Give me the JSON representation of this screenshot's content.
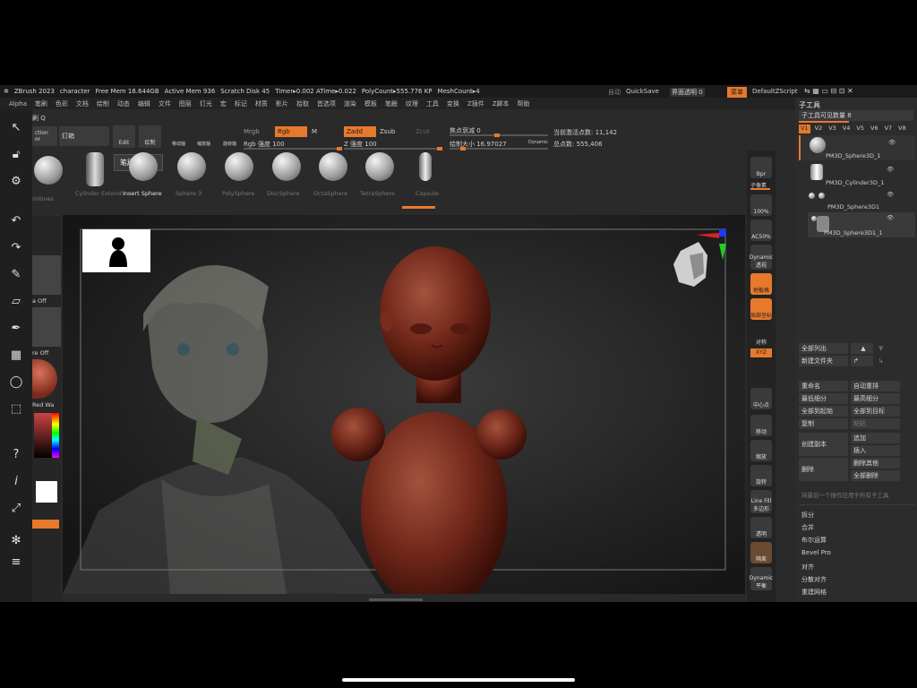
{
  "status": {
    "app": "ZBrush 2023",
    "doc": "character",
    "free_mem": "Free Mem 16.644GB",
    "active_mem": "Active Mem 936",
    "scratch": "Scratch Disk 45",
    "timer": "Timer▸0.002 ATime▸0.022",
    "polycount": "PolyCount▸555.776 KP",
    "meshcount": "MeshCount▸4",
    "auto": "自动",
    "quicksave": "QuickSave",
    "transparency": "界面透明 0",
    "menu_btn": "菜单",
    "script": "DefaultZScript"
  },
  "menus": [
    "Alpha",
    "笔刷",
    "色彩",
    "文档",
    "绘制",
    "动态",
    "编辑",
    "文件",
    "图层",
    "灯光",
    "宏",
    "标记",
    "材质",
    "影片",
    "拾取",
    "首选项",
    "渲染",
    "模板",
    "笔触",
    "纹理",
    "工具",
    "变换",
    "Z插件",
    "Z脚本",
    "帮助"
  ],
  "topbar": {
    "brush_header": "刷 Q",
    "section_label": "ction",
    "section_sub": "or",
    "lighting": "灯箱",
    "edit": "Edit",
    "draw": "绘制",
    "move": "移动轴",
    "scale": "缩放轴",
    "rotate": "旋转轴",
    "mrgb": "Mrgb",
    "rgb": "Rgb",
    "m": "M",
    "rgb_intensity": "Rgb 强度 100",
    "zadd": "Zadd",
    "zsub": "Zsub",
    "zcut": "Zcut",
    "z_intensity": "Z 强度 100",
    "focal": "焦点衰减 0",
    "draw_size": "绘制大小 16.97027",
    "dynamic": "Dynamic",
    "active_points": "当前激活点数: 11,142",
    "total_points": "总点数: 555,406",
    "tooltip": "笔刷绘制 Q"
  },
  "shelf": [
    "Cylinder Extend",
    "Insert Sphere",
    "Sphere 3",
    "PolySphere",
    "DiscSphere",
    "OctaSphere",
    "TetraSphere",
    "Capsule"
  ],
  "shelf_left": "mitives",
  "left_panel": {
    "a_off": "a Off",
    "re_off": "re Off",
    "red_wax": "Red Wa"
  },
  "right_strip": [
    "Bpr",
    "子像素",
    "100%",
    "AC50%",
    "Dynamic 透视",
    "地板格",
    "局部坐标",
    "对称",
    "XYZ",
    "中心点",
    "移动",
    "缩放",
    "旋转",
    "Line Fill 多边形",
    "透明",
    "隔离",
    "Dynamic 平衡"
  ],
  "subtool": {
    "title": "子工具",
    "visible_count": "子工具可见数量 8",
    "versions": [
      "V1",
      "V2",
      "V3",
      "V4",
      "V5",
      "V6",
      "V7",
      "V8"
    ],
    "items": [
      "PM3D_Sphere3D_1",
      "PM3D_Cylinder3D_1",
      "PM3D_Sphere3D1",
      "PM3D_Sphere3D1_1"
    ],
    "list_all": "全部列出",
    "new_folder": "新建文件夹",
    "rename": "重命名",
    "auto_reorder": "自动重排",
    "lowest_sub": "最低细分",
    "highest_sub": "最高细分",
    "all_to_start": "全部到起始",
    "all_to_target": "全部到目标",
    "duplicate": "复制",
    "paste": "粘贴",
    "create_copy": "创建副本",
    "append": "追加",
    "insert": "插入",
    "delete": "删除",
    "delete_others": "删除其他",
    "delete_all": "全部删除",
    "apply_hint": "将最后一个操作应用于所有子工具",
    "split": "拆分",
    "merge": "合并",
    "boolean": "布尔运算",
    "bevel": "Bevel Pro",
    "align": "对齐",
    "distribute": "分散对齐",
    "remesh": "重建网格"
  },
  "colors": {
    "accent": "#e8782c",
    "bg": "#2a2a2a",
    "clay": "#7a2a1e"
  }
}
